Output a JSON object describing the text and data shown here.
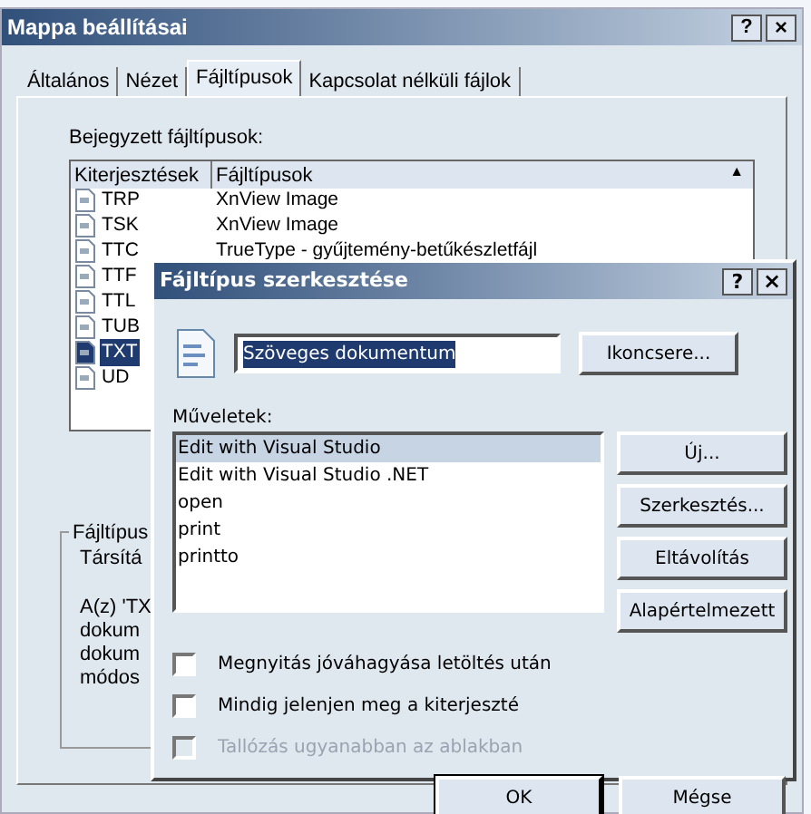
{
  "window": {
    "title": "Mappa beállításai",
    "help": "?",
    "close": "×"
  },
  "tabs": [
    {
      "label": "Általános",
      "selected": false
    },
    {
      "label": "Nézet",
      "selected": false
    },
    {
      "label": "Fájltípusok",
      "selected": true
    },
    {
      "label": "Kapcsolat nélküli fájlok",
      "selected": false
    }
  ],
  "registered_label": "Bejegyzett fájltípusok:",
  "table": {
    "columns": [
      "Kiterjesztések",
      "Fájltípusok"
    ],
    "sort_arrow": "▲",
    "rows": [
      {
        "ext": "TRP",
        "type": "XnView Image",
        "selected": false
      },
      {
        "ext": "TSK",
        "type": "XnView Image",
        "selected": false
      },
      {
        "ext": "TTC",
        "type": "TrueType - gyűjtemény-betűkészletfájl",
        "selected": false
      },
      {
        "ext": "TTF",
        "selected": false
      },
      {
        "ext": "TTL",
        "selected": false
      },
      {
        "ext": "TUB",
        "selected": false
      },
      {
        "ext": "TXT",
        "selected": true
      },
      {
        "ext": "UD",
        "selected": false
      }
    ]
  },
  "group": {
    "title": "Fájltípus",
    "lines": [
      "Társítá",
      "A(z) 'TX",
      "dokum",
      "dokum",
      "módos"
    ]
  },
  "dialog": {
    "title": "Fájltípus szerkesztése",
    "help": "?",
    "close": "×",
    "name_value": "Szöveges dokumentum",
    "icon_button": "Ikoncsere...",
    "actions_label": "Műveletek:",
    "actions": [
      {
        "label": "Edit with Visual Studio",
        "selected": true
      },
      {
        "label": "Edit with Visual Studio .NET",
        "selected": false
      },
      {
        "label": "open",
        "selected": false
      },
      {
        "label": "print",
        "selected": false
      },
      {
        "label": "printto",
        "selected": false
      }
    ],
    "side_buttons": [
      "Új...",
      "Szerkesztés...",
      "Eltávolítás",
      "Alapértelmezett"
    ],
    "checkboxes": [
      {
        "label": "Megnyitás jóváhagyása letöltés után",
        "checked": false,
        "disabled": false
      },
      {
        "label": "Mindig jelenjen meg a kiterjeszté",
        "checked": false,
        "disabled": false
      },
      {
        "label": "Tallózás ugyanabban az ablakban",
        "checked": false,
        "disabled": true
      }
    ],
    "buttons": [
      {
        "label": "OK",
        "default": true
      },
      {
        "label": "Mégse",
        "default": false
      }
    ]
  }
}
